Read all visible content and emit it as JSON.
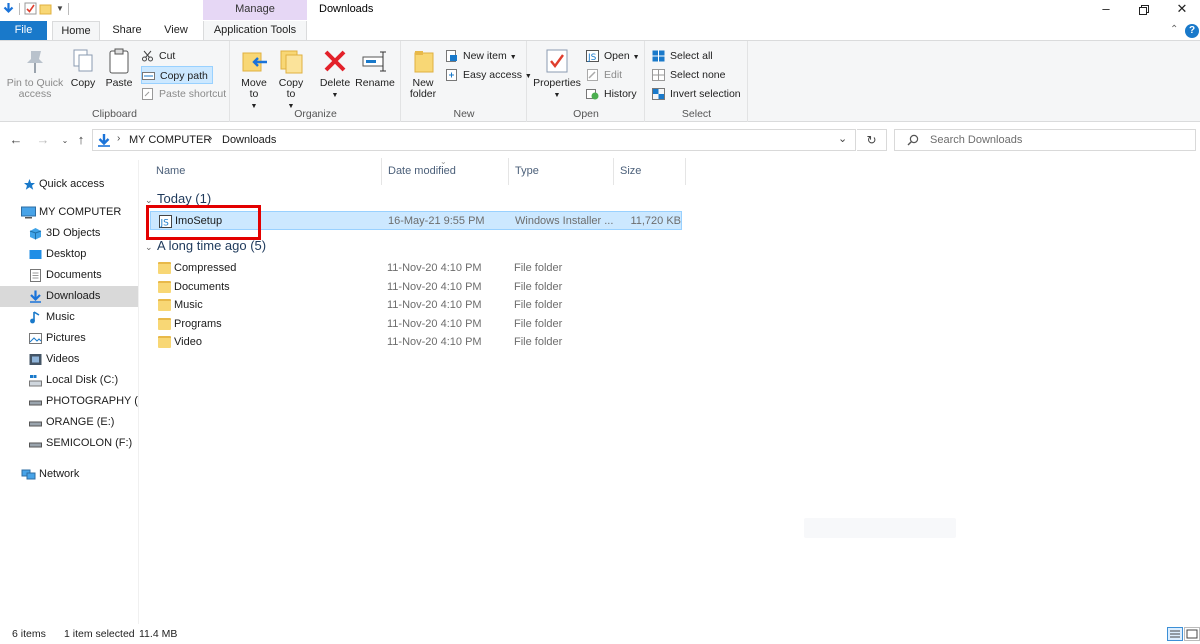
{
  "titlebar": {
    "context_tab_label": "Manage",
    "window_title": "Downloads"
  },
  "tabs": {
    "file": "File",
    "home": "Home",
    "share": "Share",
    "view": "View",
    "app_tools": "Application Tools"
  },
  "ribbon": {
    "clipboard": {
      "label": "Clipboard",
      "pin": "Pin to Quick access",
      "copy": "Copy",
      "paste": "Paste",
      "cut": "Cut",
      "copy_path": "Copy path",
      "paste_shortcut": "Paste shortcut"
    },
    "organize": {
      "label": "Organize",
      "move_to": "Move to",
      "copy_to": "Copy to",
      "delete": "Delete",
      "rename": "Rename"
    },
    "new": {
      "label": "New",
      "new_folder": "New folder",
      "new_item": "New item",
      "easy_access": "Easy access"
    },
    "open": {
      "label": "Open",
      "properties": "Properties",
      "open": "Open",
      "edit": "Edit",
      "history": "History"
    },
    "select": {
      "label": "Select",
      "select_all": "Select all",
      "select_none": "Select none",
      "invert": "Invert selection"
    }
  },
  "address": {
    "breadcrumb_root": "MY COMPUTER",
    "breadcrumb_current": "Downloads",
    "search_placeholder": "Search Downloads"
  },
  "nav": {
    "quick_access": "Quick access",
    "my_computer": "MY COMPUTER",
    "objects_3d": "3D Objects",
    "desktop": "Desktop",
    "documents": "Documents",
    "downloads": "Downloads",
    "music": "Music",
    "pictures": "Pictures",
    "videos": "Videos",
    "local_disk": "Local Disk (C:)",
    "photography": "PHOTOGRAPHY (D:",
    "orange": "ORANGE (E:)",
    "semicolon": "SEMICOLON (F:)",
    "network": "Network"
  },
  "columns": {
    "name": "Name",
    "date": "Date modified",
    "type": "Type",
    "size": "Size"
  },
  "groups": {
    "today": "Today (1)",
    "long_ago": "A long time ago (5)"
  },
  "files": {
    "today": [
      {
        "name": "ImoSetup",
        "date": "16-May-21 9:55 PM",
        "type": "Windows Installer ...",
        "size": "11,720 KB"
      }
    ],
    "long_ago": [
      {
        "name": "Compressed",
        "date": "11-Nov-20 4:10 PM",
        "type": "File folder",
        "size": ""
      },
      {
        "name": "Documents",
        "date": "11-Nov-20 4:10 PM",
        "type": "File folder",
        "size": ""
      },
      {
        "name": "Music",
        "date": "11-Nov-20 4:10 PM",
        "type": "File folder",
        "size": ""
      },
      {
        "name": "Programs",
        "date": "11-Nov-20 4:10 PM",
        "type": "File folder",
        "size": ""
      },
      {
        "name": "Video",
        "date": "11-Nov-20 4:10 PM",
        "type": "File folder",
        "size": ""
      }
    ]
  },
  "status": {
    "items": "6 items",
    "selected": "1 item selected",
    "size": "11.4 MB"
  },
  "colors": {
    "accent": "#1979ca",
    "manage_tab": "#e6d7f5",
    "selection": "#cce8ff",
    "highlight_box": "#e30000",
    "folder": "#f8d775"
  }
}
